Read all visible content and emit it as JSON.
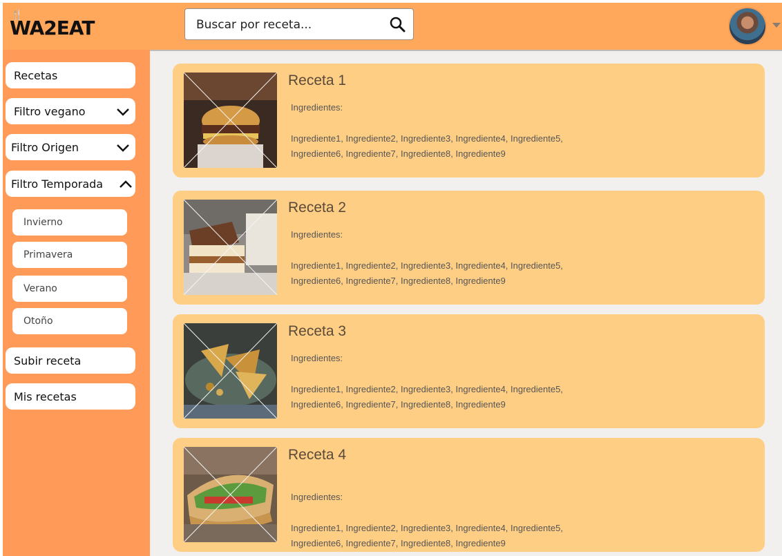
{
  "brand": {
    "logo_text": "WA2EAT"
  },
  "search": {
    "placeholder": "Buscar por receta..."
  },
  "icons": {
    "search": "search-icon",
    "chevron_down": "chevron-down-icon",
    "chevron_up": "chevron-up-icon",
    "avatar_caret": "caret-down-icon"
  },
  "colors": {
    "topbar": "#FFA85C",
    "sidebar": "#FF9A58",
    "card": "#FFCE85",
    "content_bg": "#F2F0EF"
  },
  "sidebar": {
    "recetas": "Recetas",
    "filtro_vegano": "Filtro vegano",
    "filtro_origen": "Filtro Origen",
    "filtro_temporada": "Filtro Temporada",
    "temporadas": [
      "Invierno",
      "Primavera",
      "Verano",
      "Otoño"
    ],
    "subir_receta": "Subir receta",
    "mis_recetas": "Mis recetas"
  },
  "recipes": [
    {
      "title": "Receta 1",
      "ingredients_label": "Ingredientes:",
      "ingredients_line1": "Ingrediente1, Ingrediente2, Ingrediente3, Ingrediente4, Ingrediente5,",
      "ingredients_line2": "Ingrediente6, Ingrediente7, Ingrediente8, Ingrediente9"
    },
    {
      "title": "Receta 2",
      "ingredients_label": "Ingredientes:",
      "ingredients_line1": "Ingrediente1, Ingrediente2, Ingrediente3, Ingrediente4, Ingrediente5,",
      "ingredients_line2": "Ingrediente6, Ingrediente7, Ingrediente8, Ingrediente9"
    },
    {
      "title": "Receta 3",
      "ingredients_label": "Ingredientes:",
      "ingredients_line1": "Ingrediente1, Ingrediente2, Ingrediente3, Ingrediente4, Ingrediente5,",
      "ingredients_line2": "Ingrediente6, Ingrediente7, Ingrediente8, Ingrediente9"
    },
    {
      "title": "Receta 4",
      "ingredients_label": "Ingredientes:",
      "ingredients_line1": "Ingrediente1, Ingrediente2, Ingrediente3, Ingrediente4, Ingrediente5,",
      "ingredients_line2": "Ingrediente6, Ingrediente7, Ingrediente8, Ingrediente9"
    }
  ]
}
